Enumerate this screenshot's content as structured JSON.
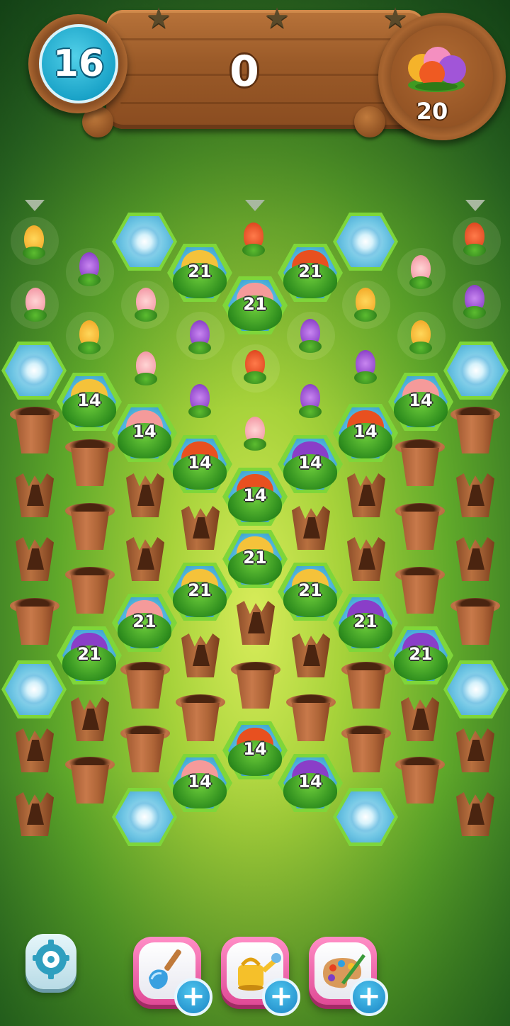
{
  "hud": {
    "moves_left": "16",
    "score": "0",
    "goal_count": "20",
    "stars_earned": 0,
    "stars_total": 3
  },
  "board": {
    "bushes": [
      {
        "number": "21",
        "color": "#f5c23a"
      },
      {
        "number": "21",
        "color": "#e8501f"
      },
      {
        "number": "21",
        "color": "#f59a9a"
      },
      {
        "number": "14",
        "color": "#f5c23a"
      },
      {
        "number": "14",
        "color": "#f59a9a"
      },
      {
        "number": "14",
        "color": "#e8501f"
      },
      {
        "number": "14",
        "color": "#f59a9a"
      },
      {
        "number": "14",
        "color": "#e8501f"
      },
      {
        "number": "14",
        "color": "#8a3ec8"
      },
      {
        "number": "14",
        "color": "#e8501f"
      },
      {
        "number": "21",
        "color": "#f5c23a"
      },
      {
        "number": "21",
        "color": "#f5c23a"
      },
      {
        "number": "21",
        "color": "#f5c23a"
      },
      {
        "number": "21",
        "color": "#f59a9a"
      },
      {
        "number": "21",
        "color": "#8a3ec8"
      },
      {
        "number": "21",
        "color": "#8a3ec8"
      },
      {
        "number": "21",
        "color": "#8a3ec8"
      },
      {
        "number": "14",
        "color": "#e8501f"
      },
      {
        "number": "14",
        "color": "#f59a9a"
      },
      {
        "number": "14",
        "color": "#8a3ec8"
      }
    ]
  },
  "colors": {
    "orange": "#e8501f",
    "yellow": "#f5c23a",
    "pink": "#f59a9a",
    "purple": "#8a3ec8",
    "water_tile": "#6ec5e4",
    "grass_border": "#7ed63a"
  },
  "toolbar": {
    "settings_icon": "gear-icon",
    "boosters": [
      {
        "icon": "shovel-icon",
        "plus": "+"
      },
      {
        "icon": "watering-can-icon",
        "plus": "+"
      },
      {
        "icon": "paint-palette-icon",
        "plus": "+"
      }
    ]
  }
}
